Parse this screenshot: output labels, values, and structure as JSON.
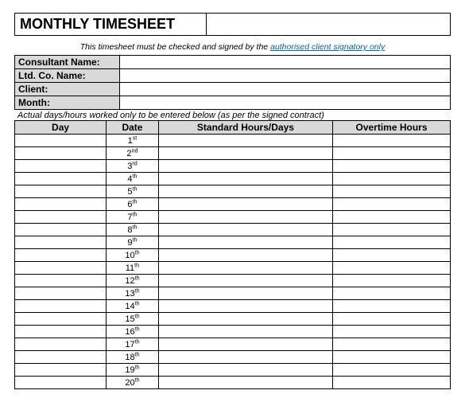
{
  "title": "MONTHLY TIMESHEET",
  "notice_pre": "This timesheet must be checked and signed by the ",
  "notice_link": "authorised client signatory only",
  "info": {
    "consultant_label": "Consultant Name:",
    "consultant_value": "",
    "company_label": "Ltd. Co. Name:",
    "company_value": "",
    "client_label": "Client:",
    "client_value": "",
    "month_label": "Month:",
    "month_value": ""
  },
  "subnote": "Actual days/hours worked only to be entered below (as per the signed contract)",
  "headers": {
    "day": "Day",
    "date": "Date",
    "std": "Standard Hours/Days",
    "ot": "Overtime Hours"
  },
  "rows": [
    {
      "day": "",
      "date_num": "1",
      "date_suf": "st",
      "std": "",
      "ot": ""
    },
    {
      "day": "",
      "date_num": "2",
      "date_suf": "nd",
      "std": "",
      "ot": ""
    },
    {
      "day": "",
      "date_num": "3",
      "date_suf": "rd",
      "std": "",
      "ot": ""
    },
    {
      "day": "",
      "date_num": "4",
      "date_suf": "th",
      "std": "",
      "ot": ""
    },
    {
      "day": "",
      "date_num": "5",
      "date_suf": "th",
      "std": "",
      "ot": ""
    },
    {
      "day": "",
      "date_num": "6",
      "date_suf": "th",
      "std": "",
      "ot": ""
    },
    {
      "day": "",
      "date_num": "7",
      "date_suf": "th",
      "std": "",
      "ot": ""
    },
    {
      "day": "",
      "date_num": "8",
      "date_suf": "th",
      "std": "",
      "ot": ""
    },
    {
      "day": "",
      "date_num": "9",
      "date_suf": "th",
      "std": "",
      "ot": ""
    },
    {
      "day": "",
      "date_num": "10",
      "date_suf": "th",
      "std": "",
      "ot": ""
    },
    {
      "day": "",
      "date_num": "11",
      "date_suf": "th",
      "std": "",
      "ot": ""
    },
    {
      "day": "",
      "date_num": "12",
      "date_suf": "th",
      "std": "",
      "ot": ""
    },
    {
      "day": "",
      "date_num": "13",
      "date_suf": "th",
      "std": "",
      "ot": ""
    },
    {
      "day": "",
      "date_num": "14",
      "date_suf": "th",
      "std": "",
      "ot": ""
    },
    {
      "day": "",
      "date_num": "15",
      "date_suf": "th",
      "std": "",
      "ot": ""
    },
    {
      "day": "",
      "date_num": "16",
      "date_suf": "th",
      "std": "",
      "ot": ""
    },
    {
      "day": "",
      "date_num": "17",
      "date_suf": "th",
      "std": "",
      "ot": ""
    },
    {
      "day": "",
      "date_num": "18",
      "date_suf": "th",
      "std": "",
      "ot": ""
    },
    {
      "day": "",
      "date_num": "19",
      "date_suf": "th",
      "std": "",
      "ot": ""
    },
    {
      "day": "",
      "date_num": "20",
      "date_suf": "th",
      "std": "",
      "ot": ""
    }
  ]
}
